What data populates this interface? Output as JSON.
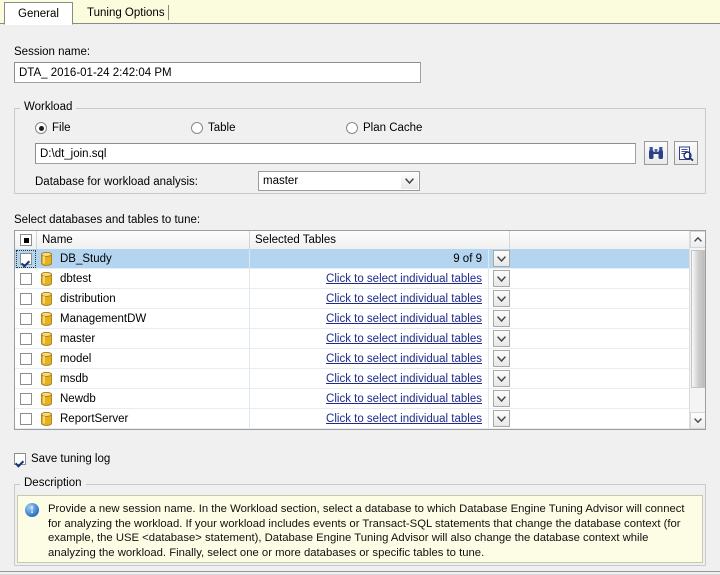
{
  "tabs": [
    {
      "label": "General",
      "active": true
    },
    {
      "label": "Tuning Options",
      "active": false
    }
  ],
  "session": {
    "label": "Session name:",
    "value": "DTA_ 2016-01-24 2:42:04 PM"
  },
  "workload": {
    "title": "Workload",
    "options": [
      {
        "label": "File",
        "selected": true
      },
      {
        "label": "Table",
        "selected": false
      },
      {
        "label": "Plan Cache",
        "selected": false
      }
    ],
    "file_value": "D:\\dt_join.sql",
    "browse_icon": "binoculars-icon",
    "preview_icon": "preview-workload-icon",
    "db_label": "Database for workload analysis:",
    "db_value": "master",
    "db_arrow_icon": "chevron-down-icon"
  },
  "grid": {
    "label": "Select databases and tables to tune:",
    "header_check_icon": "partial-check-icon",
    "columns": [
      "Name",
      "Selected Tables"
    ],
    "rows": [
      {
        "checked": true,
        "name": "DB_Study",
        "tables": "9 of 9",
        "is_link": false,
        "selected": true
      },
      {
        "checked": false,
        "name": "dbtest",
        "tables": "Click to select individual tables",
        "is_link": true,
        "selected": false
      },
      {
        "checked": false,
        "name": "distribution",
        "tables": "Click to select individual tables",
        "is_link": true,
        "selected": false
      },
      {
        "checked": false,
        "name": "ManagementDW",
        "tables": "Click to select individual tables",
        "is_link": true,
        "selected": false
      },
      {
        "checked": false,
        "name": "master",
        "tables": "Click to select individual tables",
        "is_link": true,
        "selected": false
      },
      {
        "checked": false,
        "name": "model",
        "tables": "Click to select individual tables",
        "is_link": true,
        "selected": false
      },
      {
        "checked": false,
        "name": "msdb",
        "tables": "Click to select individual tables",
        "is_link": true,
        "selected": false
      },
      {
        "checked": false,
        "name": "Newdb",
        "tables": "Click to select individual tables",
        "is_link": true,
        "selected": false
      },
      {
        "checked": false,
        "name": "ReportServer",
        "tables": "Click to select individual tables",
        "is_link": true,
        "selected": false
      }
    ],
    "row_drop_icon": "chevron-down-icon",
    "scroll_up_icon": "caret-up-icon",
    "scroll_down_icon": "caret-down-icon"
  },
  "save_log": {
    "label": "Save tuning log",
    "checked": true
  },
  "description": {
    "title": "Description",
    "icon": "info-icon",
    "icon_glyph": "!",
    "text": "Provide a new session name. In the Workload section, select a database to which Database Engine Tuning Advisor will connect for analyzing the workload. If your workload includes events or Transact-SQL statements that change the database context (for example, the USE <database> statement), Database Engine Tuning Advisor will also change the database context while analyzing the workload. Finally, select one or more databases or specific tables to tune."
  },
  "colors": {
    "tabstrip_bg": "#fbfbdd",
    "selection": "#b4d5f0",
    "link": "#1f2b8c",
    "description_bg": "#fdfce4",
    "db_icon": "#e6b11e"
  }
}
